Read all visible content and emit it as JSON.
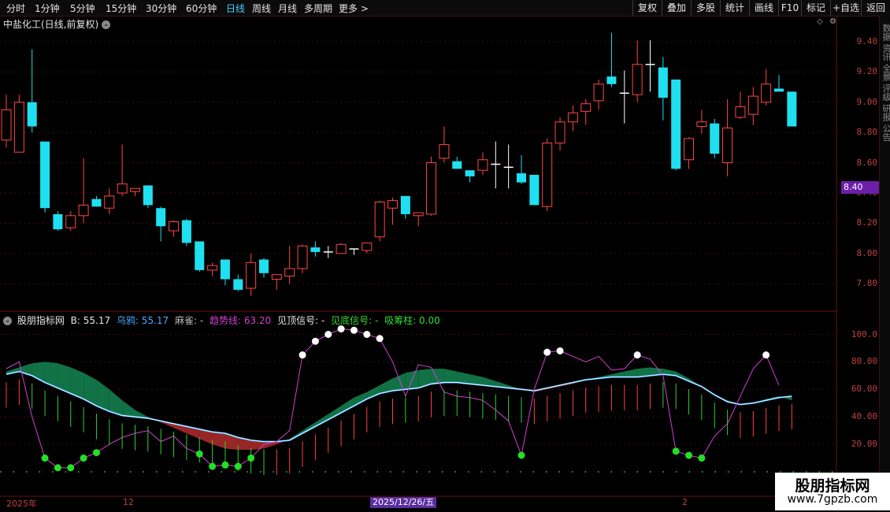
{
  "toolbar": {
    "periods": [
      "分时",
      "1分钟",
      "5分钟",
      "15分钟",
      "30分钟",
      "60分钟",
      "日线",
      "周线",
      "月线",
      "多周期",
      "更多 >"
    ],
    "active": "日线",
    "right_buttons": [
      "复权",
      "叠加",
      "多股",
      "统计",
      "画线",
      "F10",
      "标记",
      "+自选",
      "返回"
    ]
  },
  "symbol_title": "中盐化工(日线,前复权)",
  "price_axis": [
    "9.40",
    "9.20",
    "9.00",
    "8.80",
    "8.60",
    "8.40",
    "8.20",
    "8.00",
    "7.80"
  ],
  "current_price_tag": "8.40",
  "indicator": {
    "name": "股朋指标网",
    "b": "B: 55.17",
    "wuya": "乌鸦: 55.17",
    "maque": "麻雀: -",
    "trend": "趋势线: 63.20",
    "top_signal": "见顶信号: -",
    "bottom_signal": "见底信号: -",
    "absorb": "吸筹柱: 0.00",
    "axis": [
      "100.0",
      "80.00",
      "60.00",
      "40.00",
      "20.00"
    ]
  },
  "dates": {
    "d1": "2025年",
    "d2": "12",
    "selected": "2025/12/26/五",
    "d3": "2"
  },
  "watermark": {
    "title": "股朋指标网",
    "url": "www.7gpzb.com"
  },
  "sidebar_text": "数据 资讯 全景 评级 研报 公告",
  "colors": {
    "up": "#ff4545",
    "down": "#1fe0f0",
    "doji": "#ffffff",
    "trend": "#d23fd2"
  },
  "chart_data": [
    {
      "type": "candlestick",
      "title": "中盐化工(日线,前复权)",
      "ylim": [
        7.7,
        9.5
      ],
      "candles": [
        {
          "o": 8.75,
          "h": 9.05,
          "l": 8.7,
          "c": 8.95
        },
        {
          "o": 8.67,
          "h": 9.05,
          "l": 8.67,
          "c": 9.0
        },
        {
          "o": 9.0,
          "h": 9.35,
          "l": 8.8,
          "c": 8.84
        },
        {
          "o": 8.74,
          "h": 8.74,
          "l": 8.27,
          "c": 8.3
        },
        {
          "o": 8.26,
          "h": 8.28,
          "l": 8.15,
          "c": 8.16
        },
        {
          "o": 8.17,
          "h": 8.28,
          "l": 8.15,
          "c": 8.25
        },
        {
          "o": 8.25,
          "h": 8.63,
          "l": 8.2,
          "c": 8.32
        },
        {
          "o": 8.36,
          "h": 8.38,
          "l": 8.31,
          "c": 8.31
        },
        {
          "o": 8.3,
          "h": 8.43,
          "l": 8.26,
          "c": 8.38
        },
        {
          "o": 8.4,
          "h": 8.72,
          "l": 8.38,
          "c": 8.46
        },
        {
          "o": 8.41,
          "h": 8.43,
          "l": 8.38,
          "c": 8.43
        },
        {
          "o": 8.45,
          "h": 8.45,
          "l": 8.3,
          "c": 8.32
        },
        {
          "o": 8.3,
          "h": 8.31,
          "l": 8.08,
          "c": 8.18
        },
        {
          "o": 8.15,
          "h": 8.22,
          "l": 8.11,
          "c": 8.21
        },
        {
          "o": 8.22,
          "h": 8.23,
          "l": 8.05,
          "c": 8.07
        },
        {
          "o": 8.08,
          "h": 8.08,
          "l": 7.88,
          "c": 7.89
        },
        {
          "o": 7.89,
          "h": 7.94,
          "l": 7.85,
          "c": 7.92
        },
        {
          "o": 7.96,
          "h": 7.96,
          "l": 7.79,
          "c": 7.83
        },
        {
          "o": 7.83,
          "h": 7.86,
          "l": 7.75,
          "c": 7.76
        },
        {
          "o": 7.77,
          "h": 8.0,
          "l": 7.72,
          "c": 7.94
        },
        {
          "o": 7.96,
          "h": 7.97,
          "l": 7.84,
          "c": 7.87
        },
        {
          "o": 7.83,
          "h": 7.86,
          "l": 7.76,
          "c": 7.86
        },
        {
          "o": 7.85,
          "h": 8.05,
          "l": 7.8,
          "c": 7.9
        },
        {
          "o": 7.9,
          "h": 8.06,
          "l": 7.87,
          "c": 8.05
        },
        {
          "o": 8.04,
          "h": 8.08,
          "l": 7.98,
          "c": 8.01
        },
        {
          "o": 8.01,
          "h": 8.05,
          "l": 7.97,
          "c": 8.01
        },
        {
          "o": 8.0,
          "h": 8.07,
          "l": 8.01,
          "c": 8.06
        },
        {
          "o": 8.03,
          "h": 8.03,
          "l": 7.99,
          "c": 8.03
        },
        {
          "o": 8.02,
          "h": 8.07,
          "l": 8.0,
          "c": 8.07
        },
        {
          "o": 8.11,
          "h": 8.35,
          "l": 8.08,
          "c": 8.34
        },
        {
          "o": 8.3,
          "h": 8.37,
          "l": 8.19,
          "c": 8.35
        },
        {
          "o": 8.38,
          "h": 8.38,
          "l": 8.23,
          "c": 8.26
        },
        {
          "o": 8.25,
          "h": 8.27,
          "l": 8.18,
          "c": 8.27
        },
        {
          "o": 8.26,
          "h": 8.64,
          "l": 8.25,
          "c": 8.6
        },
        {
          "o": 8.63,
          "h": 8.84,
          "l": 8.6,
          "c": 8.72
        },
        {
          "o": 8.61,
          "h": 8.64,
          "l": 8.56,
          "c": 8.56
        },
        {
          "o": 8.55,
          "h": 8.55,
          "l": 8.47,
          "c": 8.51
        },
        {
          "o": 8.55,
          "h": 8.67,
          "l": 8.52,
          "c": 8.62
        },
        {
          "o": 8.59,
          "h": 8.74,
          "l": 8.43,
          "c": 8.59
        },
        {
          "o": 8.57,
          "h": 8.72,
          "l": 8.43,
          "c": 8.57
        },
        {
          "o": 8.53,
          "h": 8.65,
          "l": 8.46,
          "c": 8.47
        },
        {
          "o": 8.52,
          "h": 8.52,
          "l": 8.32,
          "c": 8.32
        },
        {
          "o": 8.31,
          "h": 8.76,
          "l": 8.28,
          "c": 8.73
        },
        {
          "o": 8.73,
          "h": 8.9,
          "l": 8.68,
          "c": 8.87
        },
        {
          "o": 8.87,
          "h": 8.98,
          "l": 8.81,
          "c": 8.93
        },
        {
          "o": 8.94,
          "h": 9.02,
          "l": 8.85,
          "c": 8.99
        },
        {
          "o": 9.01,
          "h": 9.15,
          "l": 8.95,
          "c": 9.12
        },
        {
          "o": 9.17,
          "h": 9.46,
          "l": 9.1,
          "c": 9.12
        },
        {
          "o": 9.06,
          "h": 9.21,
          "l": 8.86,
          "c": 9.06
        },
        {
          "o": 9.05,
          "h": 9.41,
          "l": 9.0,
          "c": 9.25
        },
        {
          "o": 9.25,
          "h": 9.41,
          "l": 9.07,
          "c": 9.25
        },
        {
          "o": 9.23,
          "h": 9.3,
          "l": 8.88,
          "c": 9.03
        },
        {
          "o": 9.15,
          "h": 9.15,
          "l": 8.55,
          "c": 8.56
        },
        {
          "o": 8.62,
          "h": 8.77,
          "l": 8.56,
          "c": 8.76
        },
        {
          "o": 8.84,
          "h": 8.95,
          "l": 8.79,
          "c": 8.87
        },
        {
          "o": 8.86,
          "h": 8.89,
          "l": 8.63,
          "c": 8.66
        },
        {
          "o": 8.6,
          "h": 9.02,
          "l": 8.51,
          "c": 8.83
        },
        {
          "o": 8.9,
          "h": 9.07,
          "l": 8.89,
          "c": 8.97
        },
        {
          "o": 8.92,
          "h": 9.1,
          "l": 8.85,
          "c": 9.04
        },
        {
          "o": 9.0,
          "h": 9.22,
          "l": 8.98,
          "c": 9.12
        },
        {
          "o": 9.09,
          "h": 9.18,
          "l": 9.08,
          "c": 9.07
        },
        {
          "o": 9.07,
          "h": 9.07,
          "l": 8.84,
          "c": 8.84
        }
      ]
    },
    {
      "type": "line",
      "title": "股朋指标网",
      "ylim": [
        0,
        110
      ],
      "series": [
        {
          "name": "B",
          "values": [
            71,
            73,
            70,
            65,
            61,
            57,
            53,
            48,
            44,
            41,
            40,
            39,
            37,
            35,
            33,
            31,
            29,
            28,
            25,
            23,
            22,
            22,
            23,
            28,
            33,
            38,
            43,
            48,
            53,
            57,
            59,
            60,
            61,
            64,
            65,
            65,
            64,
            63,
            62,
            61,
            60,
            59,
            61,
            63,
            65,
            67,
            68,
            69,
            69,
            69,
            70,
            71,
            70,
            66,
            62,
            56,
            51,
            49,
            50,
            52,
            54,
            55
          ]
        },
        {
          "name": "乌鸦",
          "values": [
            71,
            73,
            70,
            65,
            61,
            57,
            53,
            48,
            44,
            41,
            40,
            39,
            37,
            35,
            33,
            31,
            29,
            28,
            25,
            23,
            22,
            22,
            23,
            28,
            33,
            38,
            43,
            48,
            53,
            57,
            59,
            60,
            61,
            64,
            65,
            65,
            64,
            63,
            62,
            61,
            60,
            59,
            61,
            63,
            65,
            67,
            68,
            69,
            69,
            69,
            70,
            71,
            70,
            66,
            62,
            56,
            51,
            49,
            50,
            52,
            54,
            55
          ]
        },
        {
          "name": "麻雀",
          "values": [
            73,
            76,
            79,
            80,
            79,
            76,
            72,
            67,
            60,
            52,
            45,
            40,
            36,
            32,
            28,
            24,
            20,
            17,
            16,
            16,
            17,
            20,
            24,
            30,
            36,
            42,
            48,
            54,
            58,
            63,
            68,
            72,
            74,
            75,
            75,
            73,
            71,
            69,
            66,
            63,
            60,
            58,
            60,
            62,
            64,
            67,
            69,
            71,
            73,
            75,
            76,
            75,
            73,
            68,
            62,
            56,
            52,
            49,
            50,
            53,
            55,
            52
          ]
        },
        {
          "name": "趋势线",
          "values": [
            75,
            80,
            40,
            10,
            3,
            3,
            10,
            14,
            20,
            25,
            28,
            30,
            22,
            26,
            17,
            13,
            4,
            5,
            4,
            10,
            20,
            22,
            30,
            85,
            95,
            100,
            104,
            103,
            100,
            97,
            80,
            55,
            78,
            76,
            58,
            55,
            54,
            52,
            45,
            37,
            12,
            60,
            87,
            88,
            84,
            80,
            84,
            74,
            75,
            85,
            82,
            70,
            15,
            12,
            10,
            26,
            35,
            55,
            75,
            85,
            63
          ]
        }
      ]
    }
  ]
}
